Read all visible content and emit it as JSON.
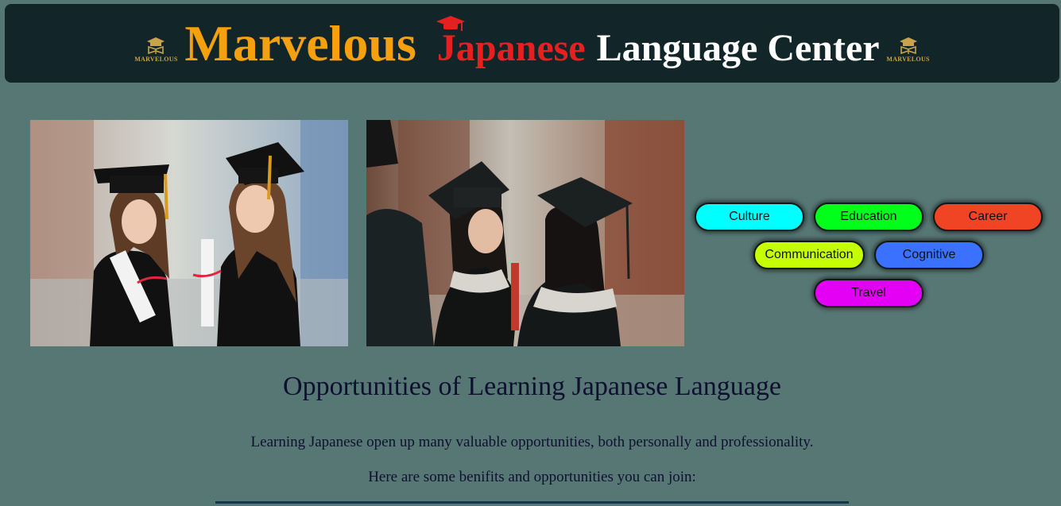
{
  "header": {
    "logo_text": "MARVELOUS",
    "title_word_1": "Marvelous",
    "title_word_2": "Japanese",
    "title_word_3": "Language Center",
    "colors": {
      "marvelous": "#f5a00e",
      "japanese": "#e42120",
      "rest": "#ffffff",
      "background": "#12262a"
    },
    "icons": [
      "graduation-book-icon",
      "graduation-cap-icon"
    ]
  },
  "tags": [
    {
      "label": "Culture",
      "color": "#00ffff"
    },
    {
      "label": "Education",
      "color": "#00ff1a"
    },
    {
      "label": "Career",
      "color": "#f04424"
    },
    {
      "label": "Communication",
      "color": "#c6ff00"
    },
    {
      "label": "Cognitive",
      "color": "#3a72ff"
    },
    {
      "label": "Travel",
      "color": "#e400f4"
    }
  ],
  "main": {
    "heading": "Opportunities of Learning Japanese Language",
    "paragraph_1": "Learning Japanese open up many valuable opportunities, both personally and professionality.",
    "paragraph_2": "Here are some benifits and opportunities you can join:"
  },
  "colors": {
    "page_background": "#577775",
    "text": "#0f1030"
  }
}
